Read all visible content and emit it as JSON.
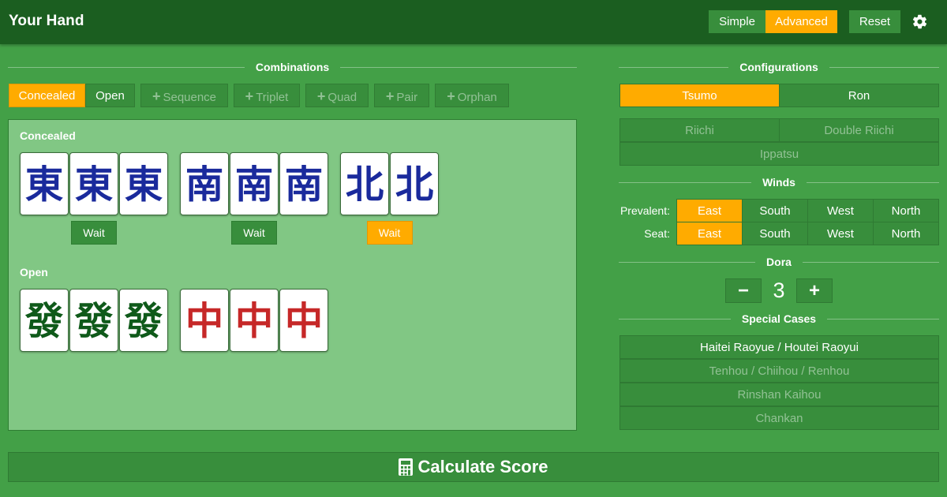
{
  "header": {
    "title": "Your Hand",
    "mode_simple": "Simple",
    "mode_advanced": "Advanced",
    "reset": "Reset",
    "settings_icon": "gear-icon"
  },
  "combinations": {
    "heading": "Combinations",
    "toggle_concealed": "Concealed",
    "toggle_open": "Open",
    "add_sequence": "Sequence",
    "add_triplet": "Triplet",
    "add_quad": "Quad",
    "add_pair": "Pair",
    "add_orphan": "Orphan",
    "add_icon": "plus-icon"
  },
  "hand": {
    "concealed_label": "Concealed",
    "open_label": "Open",
    "wait_label": "Wait",
    "tile_chars": {
      "east": "東",
      "south": "南",
      "north": "北",
      "green_dragon": "發",
      "red_dragon": "中"
    },
    "concealed_groups": [
      {
        "tile": "east",
        "count": 3,
        "wait_active": false
      },
      {
        "tile": "south",
        "count": 3,
        "wait_active": false
      },
      {
        "tile": "north",
        "count": 2,
        "wait_active": true
      }
    ],
    "open_groups": [
      {
        "tile": "green_dragon",
        "count": 3
      },
      {
        "tile": "red_dragon",
        "count": 3
      }
    ]
  },
  "configurations": {
    "heading": "Configurations",
    "tsumo": "Tsumo",
    "ron": "Ron",
    "riichi": "Riichi",
    "double_riichi": "Double Riichi",
    "ippatsu": "Ippatsu"
  },
  "winds": {
    "heading": "Winds",
    "prevalent_label": "Prevalent:",
    "seat_label": "Seat:",
    "options": [
      "East",
      "South",
      "West",
      "North"
    ],
    "prevalent_selected": "East",
    "seat_selected": "East"
  },
  "dora": {
    "heading": "Dora",
    "minus": "−",
    "plus": "+",
    "value": "3"
  },
  "special_cases": {
    "heading": "Special Cases",
    "items": [
      {
        "label": "Haitei Raoyue / Houtei Raoyui",
        "enabled": true
      },
      {
        "label": "Tenhou / Chiihou / Renhou",
        "enabled": false
      },
      {
        "label": "Rinshan Kaihou",
        "enabled": false
      },
      {
        "label": "Chankan",
        "enabled": false
      }
    ]
  },
  "calculate": {
    "label": "Calculate Score",
    "icon": "calculator-icon"
  },
  "colors": {
    "header_bg": "#1b5e20",
    "page_bg": "#43a047",
    "button_bg": "#388e3c",
    "accent": "#ffab00",
    "panel_bg": "#81c784",
    "wind_tile_ink": "#1a2a9c",
    "green_dragon_ink": "#0f5a1a",
    "red_dragon_ink": "#c62828"
  }
}
